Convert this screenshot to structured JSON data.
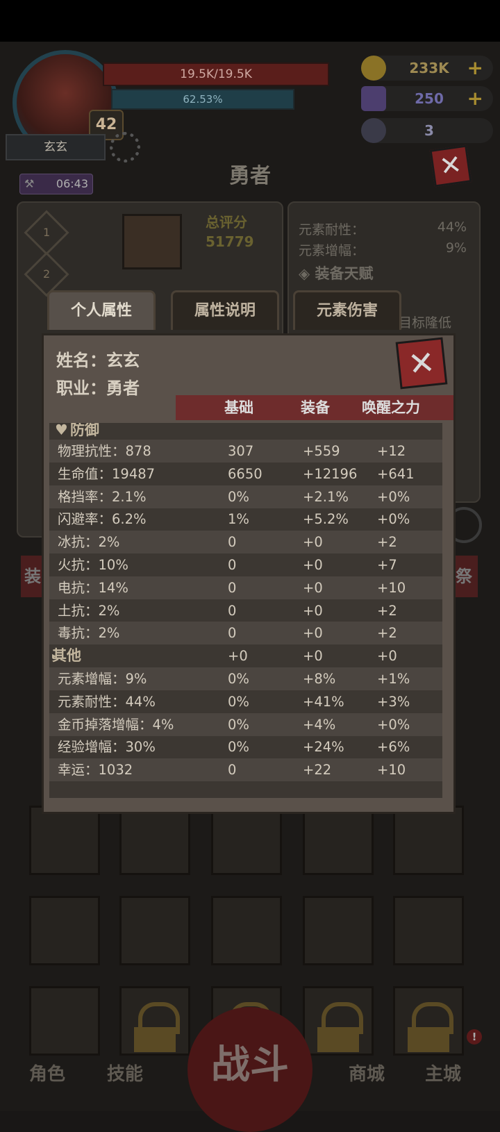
{
  "player": {
    "name": "玄玄",
    "level": "42",
    "hp_text": "19.5K/19.5K",
    "mp_text": "62.53%"
  },
  "resources": {
    "gold": "233K",
    "gems": "250",
    "keys": "3"
  },
  "hero_title": "勇者",
  "timer": "06:43",
  "summary": {
    "score_label": "总评分",
    "score_value": "51779",
    "slot1": "1",
    "slot2": "2"
  },
  "side_stats": [
    {
      "label": "元素耐性：",
      "value": "44%"
    },
    {
      "label": "元素增幅：",
      "value": "9%"
    }
  ],
  "side_section": "装备天赋",
  "side_text": "目标隆低",
  "tabs": [
    "个人属性",
    "属性说明",
    "元素伤害"
  ],
  "popup": {
    "name_label": "姓名：",
    "name_value": "玄玄",
    "class_label": "职业：",
    "class_value": "勇者",
    "columns": [
      "基础",
      "装备",
      "唤醒之力"
    ],
    "section_defense": "防御",
    "section_other": "其他",
    "other_values": [
      "+0",
      "+0",
      "+0"
    ],
    "rows_defense": [
      [
        "物理抗性：878",
        "307",
        "+559",
        "+12"
      ],
      [
        "生命值：19487",
        "6650",
        "+12196",
        "+641"
      ],
      [
        "格挡率：2.1%",
        "0%",
        "+2.1%",
        "+0%"
      ],
      [
        "闪避率：6.2%",
        "1%",
        "+5.2%",
        "+0%"
      ],
      [
        "冰抗：2%",
        "0",
        "+0",
        "+2"
      ],
      [
        "火抗：10%",
        "0",
        "+0",
        "+7"
      ],
      [
        "电抗：14%",
        "0",
        "+0",
        "+10"
      ],
      [
        "土抗：2%",
        "0",
        "+0",
        "+2"
      ],
      [
        "毒抗：2%",
        "0",
        "+0",
        "+2"
      ]
    ],
    "rows_other": [
      [
        "元素增幅：9%",
        "0%",
        "+8%",
        "+1%"
      ],
      [
        "元素耐性：44%",
        "0%",
        "+41%",
        "+3%"
      ],
      [
        "金币掉落增幅：4%",
        "0%",
        "+4%",
        "+0%"
      ],
      [
        "经验增幅：30%",
        "0%",
        "+24%",
        "+6%"
      ],
      [
        "幸运：1032",
        "0",
        "+22",
        "+10"
      ]
    ]
  },
  "nav": {
    "character": "角色",
    "skills": "技能",
    "battle": "战斗",
    "shop": "商城",
    "city": "主城"
  },
  "side_buttons": {
    "left": "装",
    "right": "祭"
  }
}
